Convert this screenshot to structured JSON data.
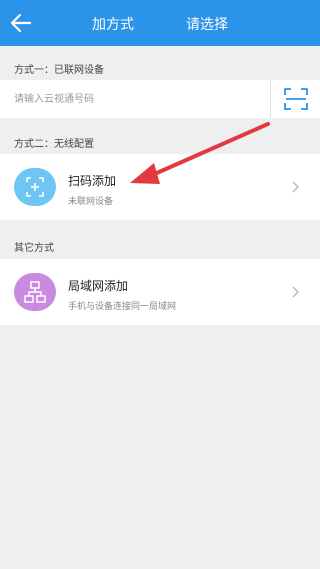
{
  "header": {
    "title_left": "加方式",
    "title_right": "请选择",
    "back_icon": "back-arrow-icon",
    "bg_color": "#2b93e8"
  },
  "method_one": {
    "section_label": "方式一：已联网设备",
    "input_placeholder": "请输入云视通号码",
    "scan_icon": "scan-frame-icon"
  },
  "method_two": {
    "section_label": "方式二：无线配置",
    "card_label": "扫码添加",
    "card_sublabel": "未联网设备",
    "icon": "scan-add-icon",
    "icon_color": "#6fc6f5"
  },
  "other": {
    "section_label": "其它方式",
    "card_label": "局域网添加",
    "card_sublabel": "手机与设备连接同一局域网",
    "icon": "lan-network-icon",
    "icon_color": "#c98be0"
  },
  "annotation": {
    "arrow_color": "#e23a3f"
  }
}
